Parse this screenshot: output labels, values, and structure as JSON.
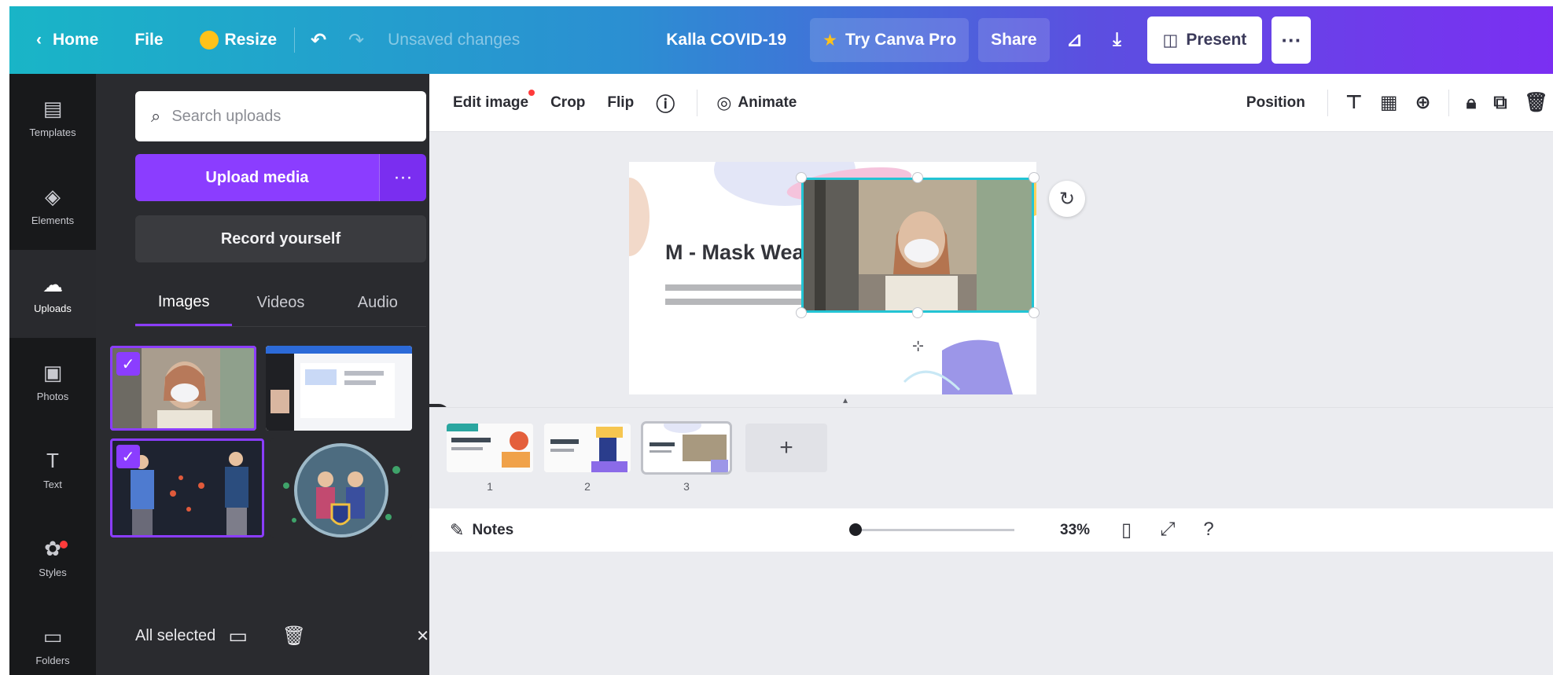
{
  "topbar": {
    "home": "Home",
    "file": "File",
    "resize": "Resize",
    "status": "Unsaved changes",
    "doc_title": "Kalla COVID-19",
    "try_pro": "Try Canva Pro",
    "share": "Share",
    "present": "Present",
    "more": "···"
  },
  "rail": {
    "items": [
      {
        "label": "Templates",
        "icon": "▤"
      },
      {
        "label": "Elements",
        "icon": "◈"
      },
      {
        "label": "Uploads",
        "icon": "☁"
      },
      {
        "label": "Photos",
        "icon": "▣"
      },
      {
        "label": "Text",
        "icon": "T"
      },
      {
        "label": "Styles",
        "icon": "✿"
      },
      {
        "label": "Folders",
        "icon": "▭"
      }
    ]
  },
  "panel": {
    "search_placeholder": "Search uploads",
    "upload_button": "Upload media",
    "upload_more": "···",
    "record_button": "Record yourself",
    "tabs": [
      "Images",
      "Videos",
      "Audio"
    ],
    "selected_count": "All selected",
    "close": "✕"
  },
  "toolbar": {
    "edit_image": "Edit image",
    "crop": "Crop",
    "flip": "Flip",
    "animate": "Animate",
    "position": "Position"
  },
  "slide": {
    "title": "M - Mask Wearing",
    "body": "แนะนำการสวมหน้ากากอนามัย เพื่อป้องกันการแพร่เชื้อ"
  },
  "pages": {
    "numbers": [
      "1",
      "2",
      "3"
    ],
    "add": "+"
  },
  "bottombar": {
    "notes": "Notes",
    "zoom": "33%",
    "zoom_level": 0.03
  },
  "colors": {
    "accent": "#8b3dff",
    "selection": "#23c4d4",
    "panel_bg": "#2a2b2f",
    "rail_bg": "#18191b"
  }
}
